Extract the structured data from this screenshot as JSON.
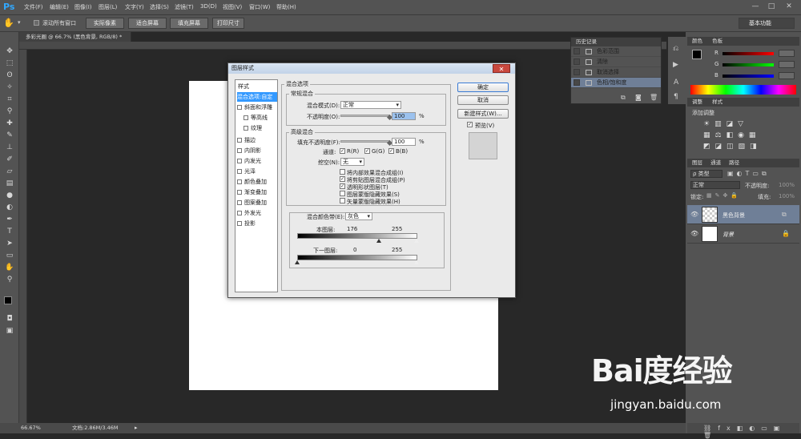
{
  "app": {
    "logo": "Ps"
  },
  "menu": [
    "文件(F)",
    "编辑(E)",
    "图像(I)",
    "图层(L)",
    "文字(Y)",
    "选择(S)",
    "滤镜(T)",
    "3D(D)",
    "视图(V)",
    "窗口(W)",
    "帮助(H)"
  ],
  "window_controls": {
    "minimize": "—",
    "restore": "□",
    "close": "✕"
  },
  "options": {
    "scroll_all_label": "滚动所有窗口",
    "actual_pixels": "实际像素",
    "fit_screen": "适合屏幕",
    "fill_screen": "填充屏幕",
    "print_size": "打印尺寸",
    "workspace": "基本功能"
  },
  "document_tab": "多彩光圈 @ 66.7% (黑色背景, RGB/8) *",
  "status": {
    "zoom": "66.67%",
    "doc_info": "文档:2.86M/3.46M"
  },
  "history": {
    "tabs": [
      "历史记录"
    ],
    "items": [
      "色彩范围",
      "清除",
      "取消选择",
      "色相/饱和度"
    ]
  },
  "color_panel": {
    "tabs": [
      "颜色",
      "色板"
    ],
    "channels": [
      "R",
      "G",
      "B"
    ]
  },
  "adjust_panel": {
    "tabs": [
      "调整",
      "样式"
    ],
    "subtitle": "添加调整"
  },
  "layers_panel": {
    "tabs": [
      "图层",
      "通道",
      "路径"
    ],
    "kind": "ρ 类型",
    "blend": "正常",
    "opacity_label": "不透明度:",
    "opacity_value": "100%",
    "lock_label": "锁定:",
    "fill_label": "填充:",
    "fill_value": "100%",
    "layers": [
      {
        "name": "黑色背景"
      },
      {
        "name": "背景"
      }
    ]
  },
  "dialog": {
    "title": "图层样式",
    "close": "✕",
    "styles_header": "样式",
    "styles": [
      {
        "label": "混合选项:自定",
        "checkbox": false,
        "selected": true
      },
      {
        "label": "斜面和浮雕",
        "checkbox": true
      },
      {
        "label": "等高线",
        "checkbox": true,
        "indent": true
      },
      {
        "label": "纹理",
        "checkbox": true,
        "indent": true
      },
      {
        "label": "描边",
        "checkbox": true
      },
      {
        "label": "内阴影",
        "checkbox": true
      },
      {
        "label": "内发光",
        "checkbox": true
      },
      {
        "label": "光泽",
        "checkbox": true
      },
      {
        "label": "颜色叠加",
        "checkbox": true
      },
      {
        "label": "渐变叠加",
        "checkbox": true
      },
      {
        "label": "图案叠加",
        "checkbox": true
      },
      {
        "label": "外发光",
        "checkbox": true
      },
      {
        "label": "投影",
        "checkbox": true
      }
    ],
    "blend_options": {
      "section": "混合选项",
      "general": "常规混合",
      "blend_mode_label": "混合模式(D):",
      "blend_mode_value": "正常",
      "opacity_label": "不透明度(O):",
      "opacity_value": "100",
      "percent": "%",
      "advanced": "高级混合",
      "fill_opacity_label": "填充不透明度(F):",
      "fill_opacity_value": "100",
      "channels_label": "通道:",
      "channel_r": "R(R)",
      "channel_g": "G(G)",
      "channel_b": "B(B)",
      "knockout_label": "挖空(N):",
      "knockout_value": "无",
      "options": [
        {
          "label": "将内部效果混合成组(I)",
          "checked": false
        },
        {
          "label": "将剪贴图层混合成组(P)",
          "checked": true
        },
        {
          "label": "透明形状图层(T)",
          "checked": true
        },
        {
          "label": "图层蒙版隐藏效果(S)",
          "checked": false
        },
        {
          "label": "矢量蒙版隐藏效果(H)",
          "checked": false
        }
      ],
      "blend_if_label": "混合颜色带(E):",
      "blend_if_value": "灰色",
      "this_layer_label": "本图层:",
      "this_layer_low": "176",
      "this_layer_high": "255",
      "underlying_label": "下一图层:",
      "underlying_low": "0",
      "underlying_high": "255"
    },
    "buttons": {
      "ok": "确定",
      "cancel": "取消",
      "new_style": "新建样式(W)...",
      "preview": "预览(V)"
    }
  },
  "watermark": {
    "brand": "Bai度经验",
    "url": "jingyan.baidu.com"
  }
}
